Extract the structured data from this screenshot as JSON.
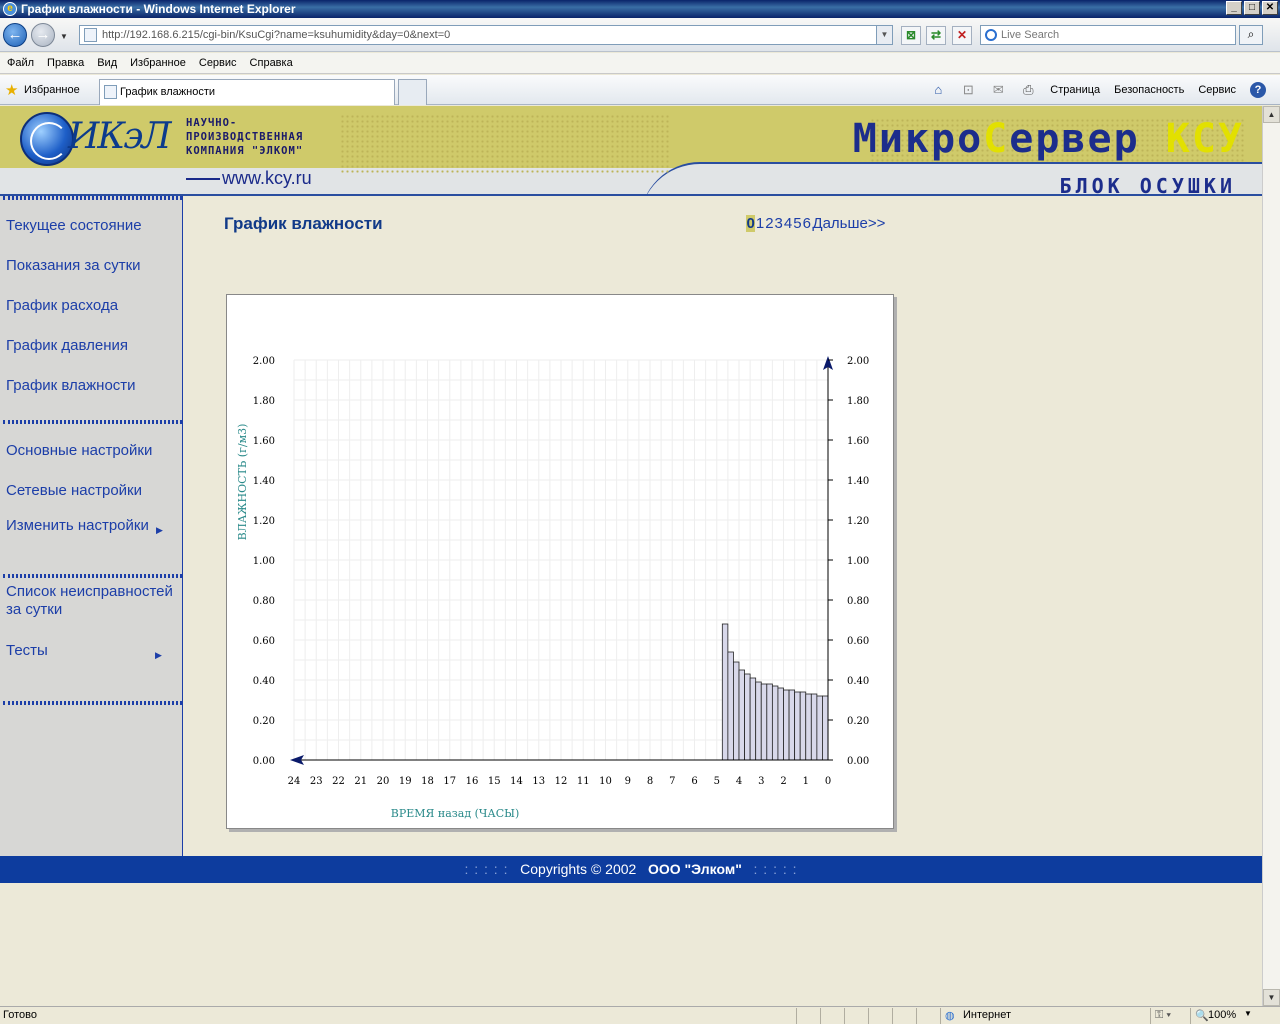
{
  "window": {
    "title": "График влажности - Windows Internet Explorer",
    "min": "_",
    "max": "□",
    "close": "✕"
  },
  "address": {
    "url": "http://192.168.6.215/cgi-bin/KsuCgi?name=ksuhumidity&day=0&next=0",
    "search_placeholder": "Live Search"
  },
  "menu": [
    "Файл",
    "Правка",
    "Вид",
    "Избранное",
    "Сервис",
    "Справка"
  ],
  "favorites": {
    "label": "Избранное",
    "tab_title": "График влажности"
  },
  "commands": {
    "page": "Страница",
    "security": "Безопасность",
    "service": "Сервис"
  },
  "header": {
    "logo": "ИКэЛ",
    "company_lines": [
      "НАУЧНО-",
      "ПРОИЗВОДСТВЕННАЯ",
      "КОМПАНИЯ \"ЭЛКОМ\""
    ],
    "website": "www.kcy.ru",
    "product_a": "Микро",
    "product_b": "С",
    "product_c": "ервер ",
    "product_d": "КСУ",
    "unit": "БЛОК ОСУШКИ"
  },
  "sidebar": {
    "items": [
      "Текущее состояние",
      "Показания за сутки",
      "График расхода",
      "График давления",
      "График влажности",
      "Основные настройки",
      "Сетевые настройки",
      "Изменить настройки",
      "Список неисправностей за сутки",
      "Тесты"
    ]
  },
  "main": {
    "title": "График влажности",
    "days": [
      "0",
      "1",
      "2",
      "3",
      "4",
      "5",
      "6"
    ],
    "selected_day": "0",
    "next_label": "Дальше>>"
  },
  "chart_data": {
    "type": "bar",
    "xlabel": "ВРЕМЯ назад (ЧАСЫ)",
    "ylabel": "ВЛАЖНОСТЬ (г/м3)",
    "ylim": [
      0,
      2
    ],
    "yticks": [
      "0.00",
      "0.20",
      "0.40",
      "0.60",
      "0.80",
      "1.00",
      "1.20",
      "1.40",
      "1.60",
      "1.80",
      "2.00"
    ],
    "x_ticks": [
      "24",
      "23",
      "22",
      "21",
      "20",
      "19",
      "18",
      "17",
      "16",
      "15",
      "14",
      "13",
      "12",
      "11",
      "10",
      "9",
      "8",
      "7",
      "6",
      "5",
      "4",
      "3",
      "2",
      "1",
      "0"
    ],
    "xlim": [
      24,
      0
    ],
    "bar_width_hours": 0.25,
    "x": [
      4.75,
      4.5,
      4.25,
      4.0,
      3.75,
      3.5,
      3.25,
      3.0,
      2.75,
      2.5,
      2.25,
      2.0,
      1.75,
      1.5,
      1.25,
      1.0,
      0.75,
      0.5,
      0.25
    ],
    "values": [
      0.68,
      0.54,
      0.49,
      0.45,
      0.43,
      0.41,
      0.39,
      0.38,
      0.38,
      0.37,
      0.36,
      0.35,
      0.35,
      0.34,
      0.34,
      0.33,
      0.33,
      0.32,
      0.32
    ],
    "grid": true,
    "bar_color": "#d8d8ea"
  },
  "footer": {
    "dots_left": ": : : : :",
    "copyright": "Copyrights  ©  2002",
    "company": "ООО \"Элком\"",
    "dots_right": ": : : : :"
  },
  "status": {
    "text": "Готово",
    "zone": "Интернет",
    "zoom": "100%"
  }
}
